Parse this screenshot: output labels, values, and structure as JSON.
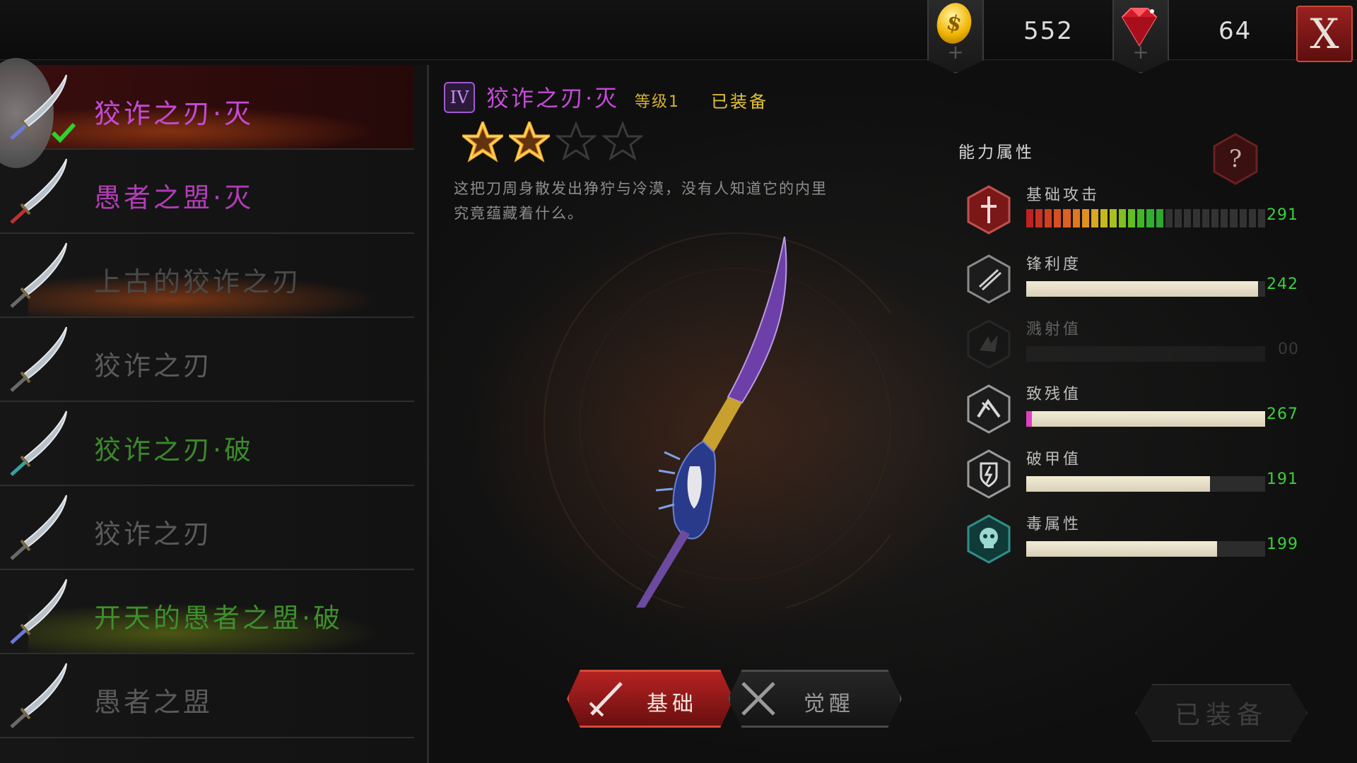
{
  "currency": {
    "gold_value": "552",
    "gem_value": "64",
    "plus_symbol": "+",
    "coin_symbol": "$",
    "close_label": "X"
  },
  "weapon_list": [
    {
      "name": "狡诈之刃·灭",
      "color": "#c64ad8",
      "selected": true,
      "equipped": true,
      "glow": "orange"
    },
    {
      "name": "愚者之盟·灭",
      "color": "#b13db6",
      "selected": false,
      "equipped": false,
      "glow": "none"
    },
    {
      "name": "上古的狡诈之刃",
      "color": "#4a4a4a",
      "selected": false,
      "equipped": false,
      "glow": "orange"
    },
    {
      "name": "狡诈之刃",
      "color": "#5a5a5a",
      "selected": false,
      "equipped": false,
      "glow": "none"
    },
    {
      "name": "狡诈之刃·破",
      "color": "#3b8a2a",
      "selected": false,
      "equipped": false,
      "glow": "none"
    },
    {
      "name": "狡诈之刃",
      "color": "#5a5a5a",
      "selected": false,
      "equipped": false,
      "glow": "none"
    },
    {
      "name": "开天的愚者之盟·破",
      "color": "#3e8f2c",
      "selected": false,
      "equipped": false,
      "glow": "green"
    },
    {
      "name": "愚者之盟",
      "color": "#5a5a5a",
      "selected": false,
      "equipped": false,
      "glow": "none"
    }
  ],
  "detail": {
    "tier_label": "IV",
    "title": "狡诈之刃·灭",
    "level": "等级1",
    "equipped_status": "已装备",
    "stars_filled": 2,
    "stars_total": 4,
    "description_line1": "这把刀周身散发出狰狞与冷漠，没有人知道它的内里",
    "description_line2": "究竟蕴藏着什么。"
  },
  "tabs": {
    "basic": "基础",
    "awaken": "觉醒"
  },
  "stats": {
    "header": "能力属性",
    "help_symbol": "?",
    "items": [
      {
        "label": "基础攻击",
        "value": "291",
        "fill": 0.58,
        "segmented": true,
        "icon": "attack-icon",
        "faded": false
      },
      {
        "label": "锋利度",
        "value": "242",
        "fill": 0.97,
        "segmented": false,
        "icon": "sharpness-icon",
        "faded": false
      },
      {
        "label": "溅射值",
        "value": "00",
        "fill": 0.0,
        "segmented": false,
        "icon": "splash-icon",
        "faded": true
      },
      {
        "label": "致残值",
        "value": "267",
        "fill": 1.0,
        "segmented": false,
        "icon": "cripple-icon",
        "faded": false
      },
      {
        "label": "破甲值",
        "value": "191",
        "fill": 0.77,
        "segmented": false,
        "icon": "armor-break-icon",
        "faded": false
      },
      {
        "label": "毒属性",
        "value": "199",
        "fill": 0.8,
        "segmented": false,
        "icon": "poison-icon",
        "faded": false
      }
    ]
  },
  "equip_button": "已装备",
  "colors": {
    "accent_red": "#b52222",
    "value_green": "#3ccf3c",
    "equipped_gold": "#e6c436",
    "title_purple": "#c64ad8"
  }
}
